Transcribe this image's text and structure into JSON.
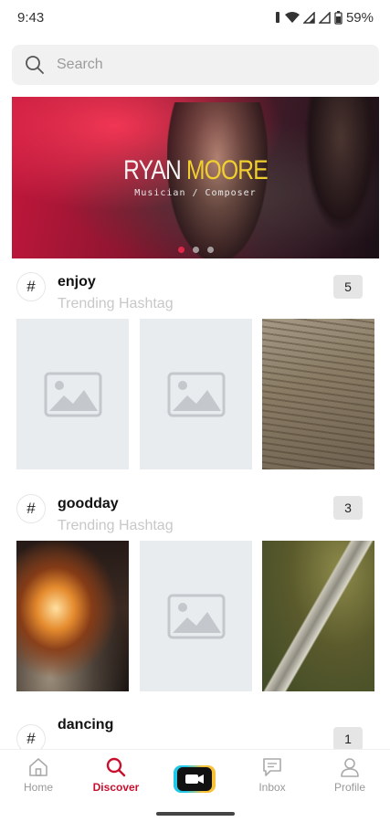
{
  "status_bar": {
    "time": "9:43",
    "battery": "59%"
  },
  "search": {
    "placeholder": "Search"
  },
  "banner": {
    "title_part1": "RYAN",
    "title_part2": "MOORE",
    "subtitle": "Musician / Composer",
    "slide_count": 3,
    "active_slide": 1
  },
  "hashtags": [
    {
      "name": "enjoy",
      "subtitle": "Trending Hashtag",
      "count": "5",
      "thumbnails": [
        "placeholder-image",
        "placeholder-image",
        "photo-wood"
      ]
    },
    {
      "name": "goodday",
      "subtitle": "Trending Hashtag",
      "count": "3",
      "thumbnails": [
        "photo-fire",
        "placeholder-image",
        "photo-rail"
      ]
    },
    {
      "name": "dancing",
      "subtitle": "",
      "count": "1",
      "thumbnails": []
    }
  ],
  "nav": {
    "items": [
      {
        "label": "Home",
        "icon": "home-icon",
        "active": false
      },
      {
        "label": "Discover",
        "icon": "search-icon",
        "active": true
      },
      {
        "label": "",
        "icon": "video-camera-icon",
        "active": false
      },
      {
        "label": "Inbox",
        "icon": "inbox-icon",
        "active": false
      },
      {
        "label": "Profile",
        "icon": "profile-icon",
        "active": false
      }
    ]
  },
  "colors": {
    "accent": "#c8102e",
    "banner_highlight": "#f1d02e"
  }
}
